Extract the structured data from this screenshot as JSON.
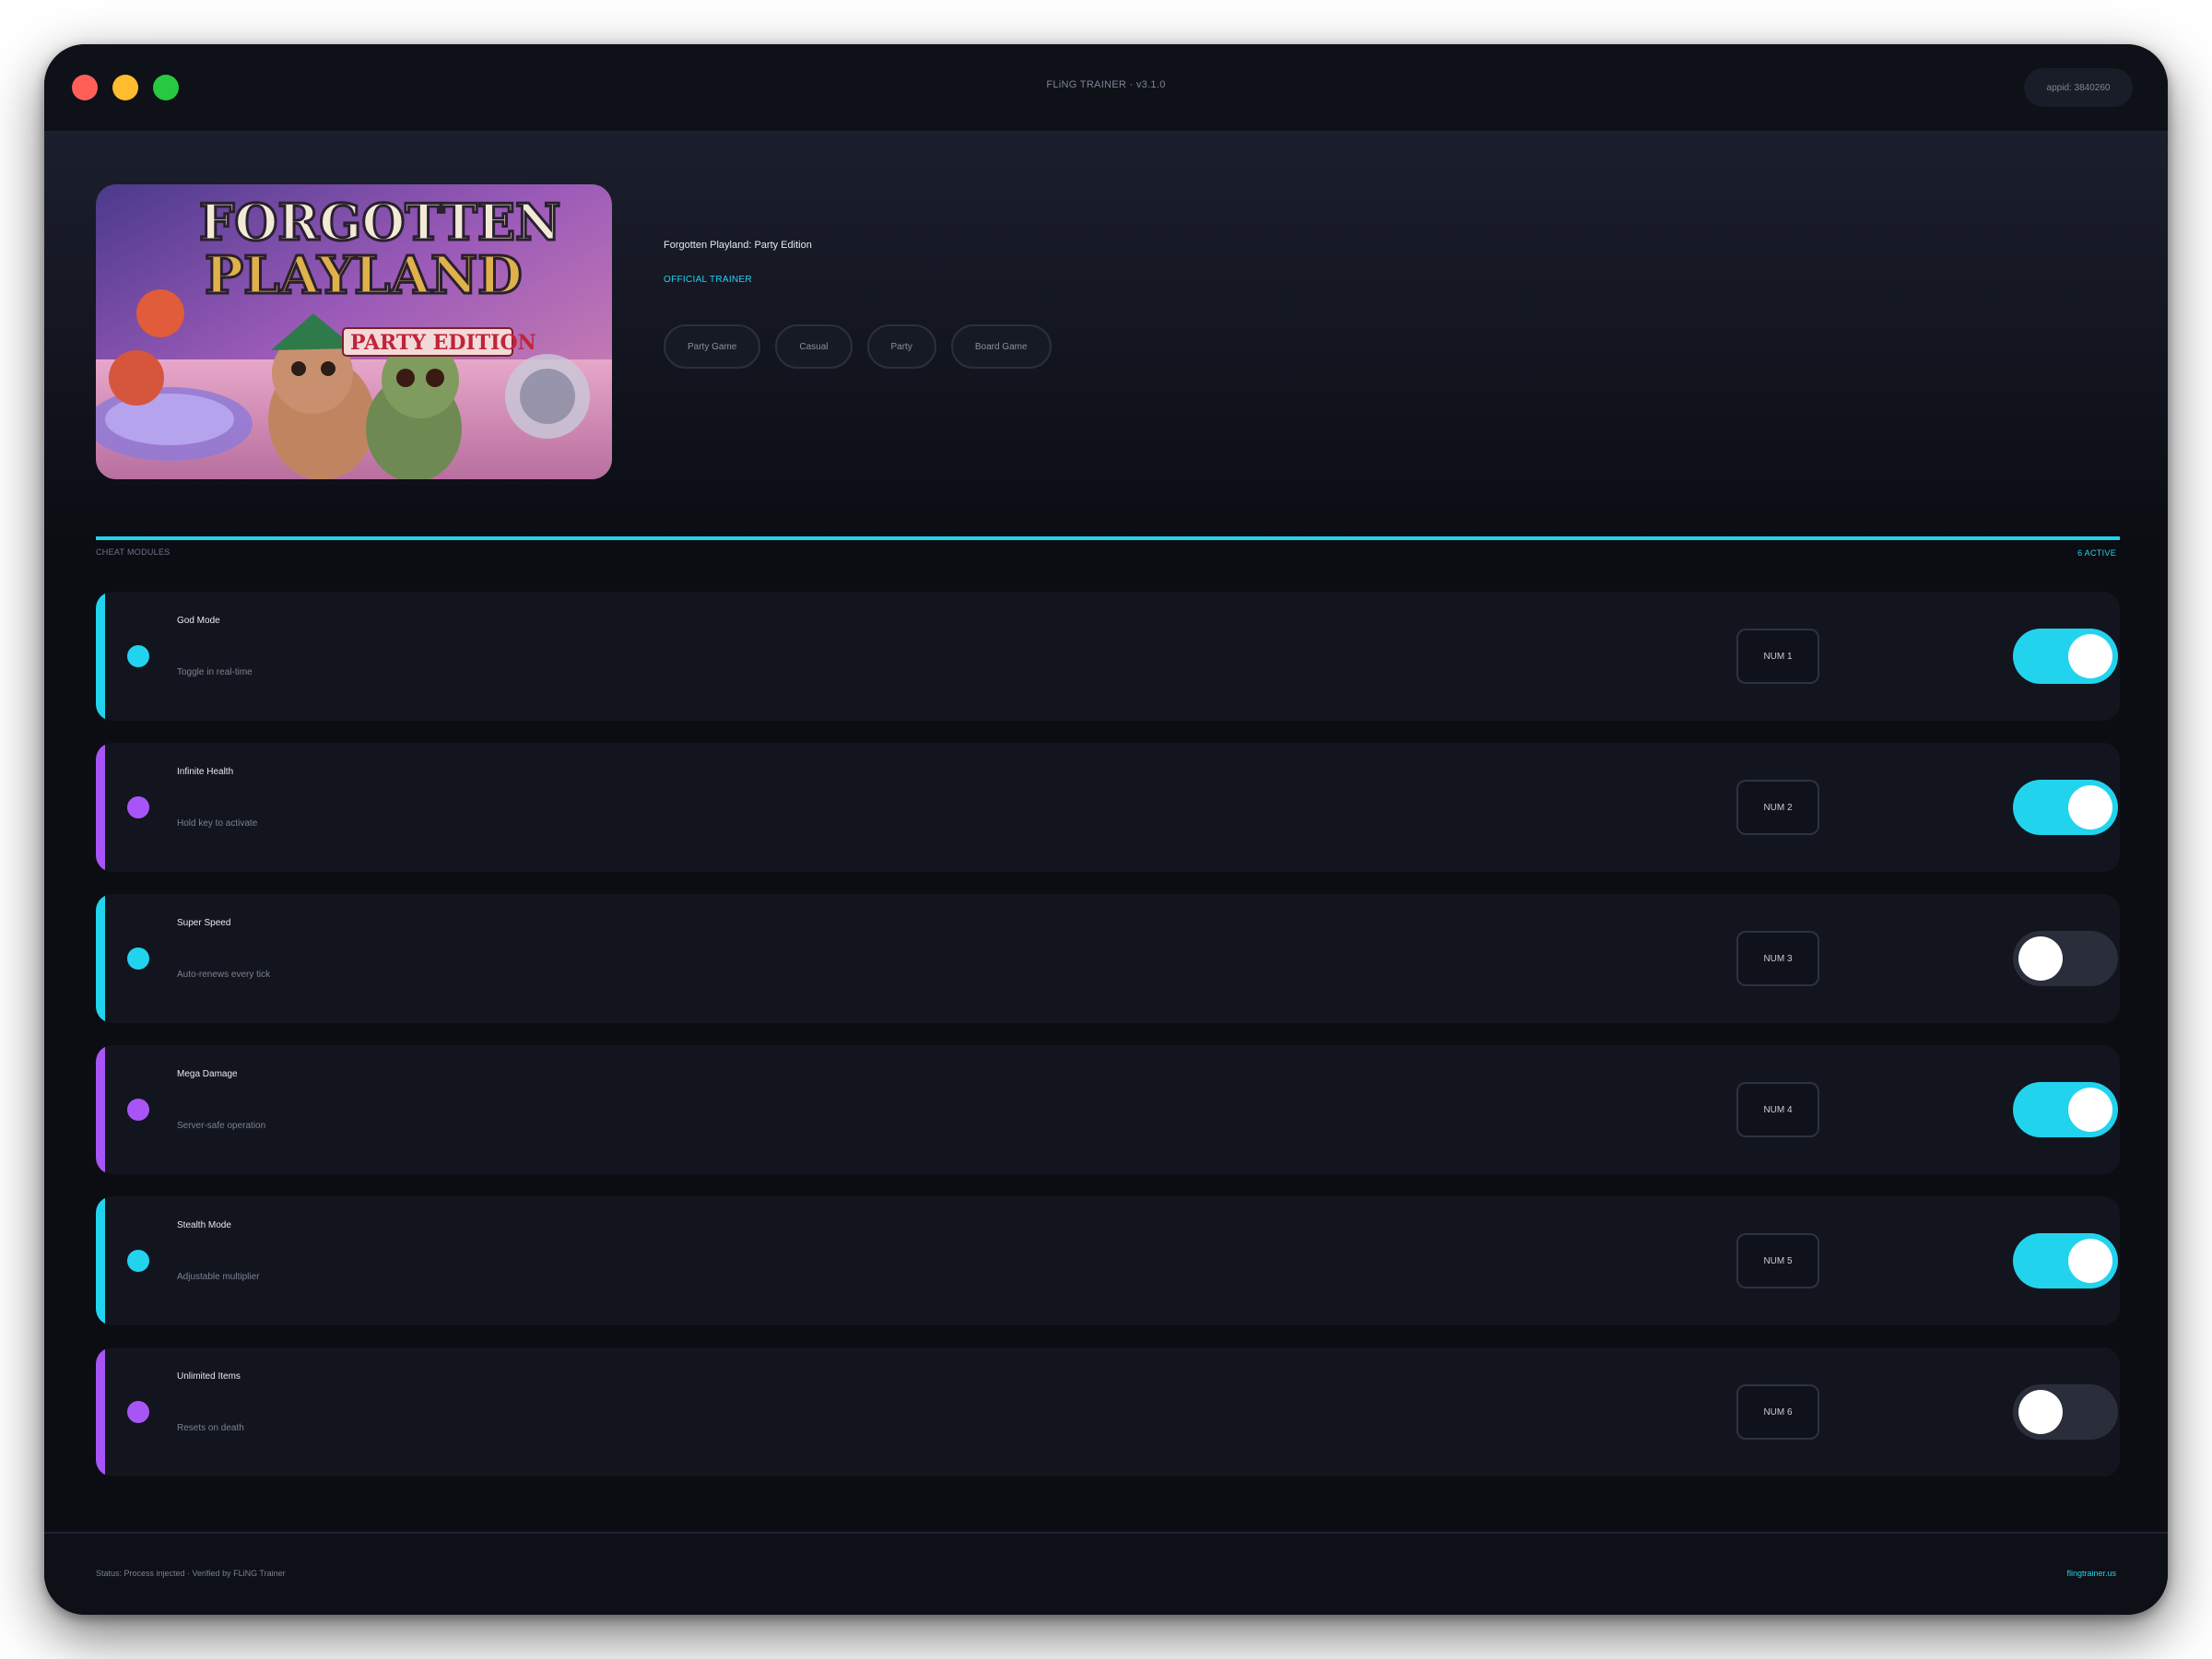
{
  "window": {
    "title": "FLiNG TRAINER · v3.1.0",
    "appid": "appid: 3840260"
  },
  "game": {
    "name": "Forgotten Playland: Party Edition",
    "badge": "OFFICIAL TRAINER",
    "cover_text": {
      "line1": "FORGOTTEN",
      "line2": "PLAYLAND",
      "line3": "PARTY EDITION"
    },
    "tags": [
      "Party Game",
      "Casual",
      "Party",
      "Board Game"
    ]
  },
  "section": {
    "label": "CHEAT MODULES",
    "active": "6 ACTIVE"
  },
  "modules": [
    {
      "name": "God Mode",
      "desc": "Toggle in real-time",
      "key": "NUM 1",
      "enabled": true,
      "accent": "#22d3ee"
    },
    {
      "name": "Infinite Health",
      "desc": "Hold key to activate",
      "key": "NUM 2",
      "enabled": true,
      "accent": "#a855f7"
    },
    {
      "name": "Super Speed",
      "desc": "Auto-renews every tick",
      "key": "NUM 3",
      "enabled": false,
      "accent": "#22d3ee"
    },
    {
      "name": "Mega Damage",
      "desc": "Server-safe operation",
      "key": "NUM 4",
      "enabled": true,
      "accent": "#a855f7"
    },
    {
      "name": "Stealth Mode",
      "desc": "Adjustable multiplier",
      "key": "NUM 5",
      "enabled": true,
      "accent": "#22d3ee"
    },
    {
      "name": "Unlimited Items",
      "desc": "Resets on death",
      "key": "NUM 6",
      "enabled": false,
      "accent": "#a855f7"
    }
  ],
  "footer": {
    "status": "Status: Process injected · Verified by FLiNG Trainer",
    "link": "flingtrainer.us"
  },
  "colors": {
    "accent_cyan": "#22d3ee",
    "accent_purple": "#a855f7",
    "toggle_off": "#2a2e3b",
    "background": "#0b0d13"
  }
}
